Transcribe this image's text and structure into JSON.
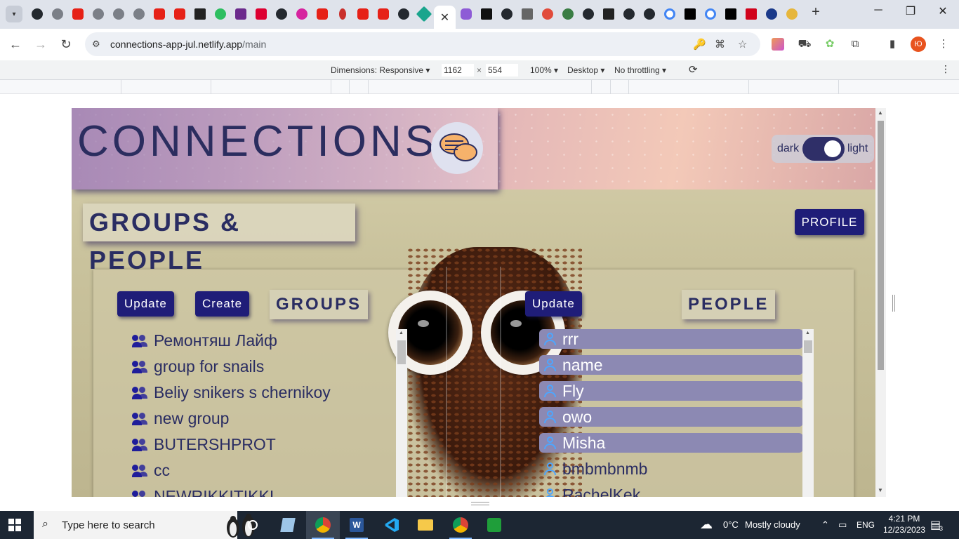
{
  "browser": {
    "url_host": "connections-app-jul.netlify.app",
    "url_path": "/main",
    "profile_initials": "Ю"
  },
  "devtools": {
    "dimensions_label": "Dimensions: Responsive",
    "width": "1162",
    "times": "×",
    "height": "554",
    "zoom": "100%",
    "device": "Desktop",
    "throttling": "No throttling"
  },
  "app": {
    "title": "CONNECTIONS",
    "theme_toggle": {
      "dark_label": "dark",
      "light_label": "light",
      "state": "light"
    },
    "page_heading": "GROUPS & PEOPLE",
    "profile_button": "PROFILE",
    "groups": {
      "update_button": "Update",
      "create_button": "Create",
      "title": "GROUPS",
      "items": [
        "Ремонтяш Лайф",
        "group for snails",
        "Beliy snikers s chernikoy",
        "new group",
        "BUTERSHPROT",
        "cc",
        "NEWRIKKITIKKI"
      ]
    },
    "people": {
      "update_button": "Update",
      "title": "PEOPLE",
      "items": [
        {
          "name": "rrr",
          "highlighted": true
        },
        {
          "name": "name",
          "highlighted": true
        },
        {
          "name": "Fly",
          "highlighted": true
        },
        {
          "name": "owo",
          "highlighted": true
        },
        {
          "name": "Misha",
          "highlighted": true
        },
        {
          "name": "bmbmbnmb",
          "highlighted": false
        },
        {
          "name": "RachelKek",
          "highlighted": false
        }
      ]
    }
  },
  "taskbar": {
    "search_placeholder": "Type here to search",
    "weather_temp": "0°C",
    "weather_text": "Mostly cloudy",
    "language": "ENG",
    "time": "4:21 PM",
    "date": "12/23/2023",
    "notification_count": "3"
  },
  "colors": {
    "accent_button": "#1f1d78",
    "title_text": "#2b2d5f",
    "person_highlight": "#8c89b3",
    "icon_blue": "#4da6ff"
  }
}
